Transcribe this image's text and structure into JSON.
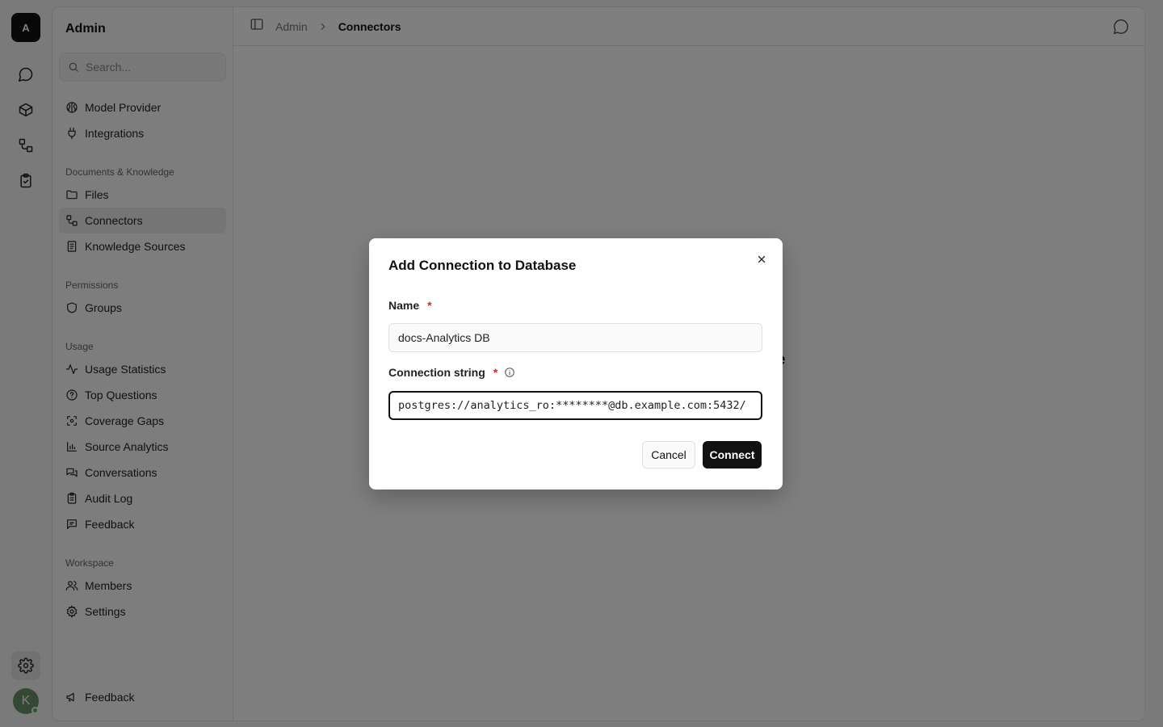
{
  "rail": {
    "logo_letter": "A",
    "avatar_letter": "K",
    "items": [
      "chat-icon",
      "box-icon",
      "connectors-icon",
      "clipboard-check-icon"
    ],
    "settings_icon": "gear-icon"
  },
  "sidebar": {
    "title": "Admin",
    "search_placeholder": "Search...",
    "top_items": [
      {
        "label": "Model Provider",
        "icon": "brain-icon"
      },
      {
        "label": "Integrations",
        "icon": "plug-icon"
      }
    ],
    "sections": [
      {
        "label": "Documents & Knowledge",
        "items": [
          {
            "label": "Files",
            "icon": "folder-icon"
          },
          {
            "label": "Connectors",
            "icon": "connectors-icon",
            "active": true
          },
          {
            "label": "Knowledge Sources",
            "icon": "book-icon"
          }
        ]
      },
      {
        "label": "Permissions",
        "items": [
          {
            "label": "Groups",
            "icon": "shield-icon"
          }
        ]
      },
      {
        "label": "Usage",
        "items": [
          {
            "label": "Usage Statistics",
            "icon": "activity-icon"
          },
          {
            "label": "Top Questions",
            "icon": "question-icon"
          },
          {
            "label": "Coverage Gaps",
            "icon": "scan-icon"
          },
          {
            "label": "Source Analytics",
            "icon": "bar-chart-icon"
          },
          {
            "label": "Conversations",
            "icon": "messages-icon"
          },
          {
            "label": "Audit Log",
            "icon": "clipboard-icon"
          },
          {
            "label": "Feedback",
            "icon": "message-square-icon"
          }
        ]
      },
      {
        "label": "Workspace",
        "items": [
          {
            "label": "Members",
            "icon": "users-icon"
          },
          {
            "label": "Settings",
            "icon": "gear-icon"
          }
        ]
      }
    ],
    "bottom_item": {
      "label": "Feedback",
      "icon": "megaphone-icon"
    }
  },
  "topbar": {
    "crumb_root": "Admin",
    "crumb_current": "Connectors"
  },
  "background": {
    "heading_fragment": "orkspace"
  },
  "modal": {
    "title": "Add Connection to Database",
    "name_label": "Name",
    "name_value": "docs-Analytics DB",
    "conn_label": "Connection string",
    "conn_value": "postgres://analytics_ro:********@db.example.com:5432/",
    "required_mark": "*",
    "cancel_label": "Cancel",
    "connect_label": "Connect"
  },
  "colors": {
    "accent": "#111111",
    "required": "#dc2626",
    "active_item_bg": "#ebebeb"
  }
}
